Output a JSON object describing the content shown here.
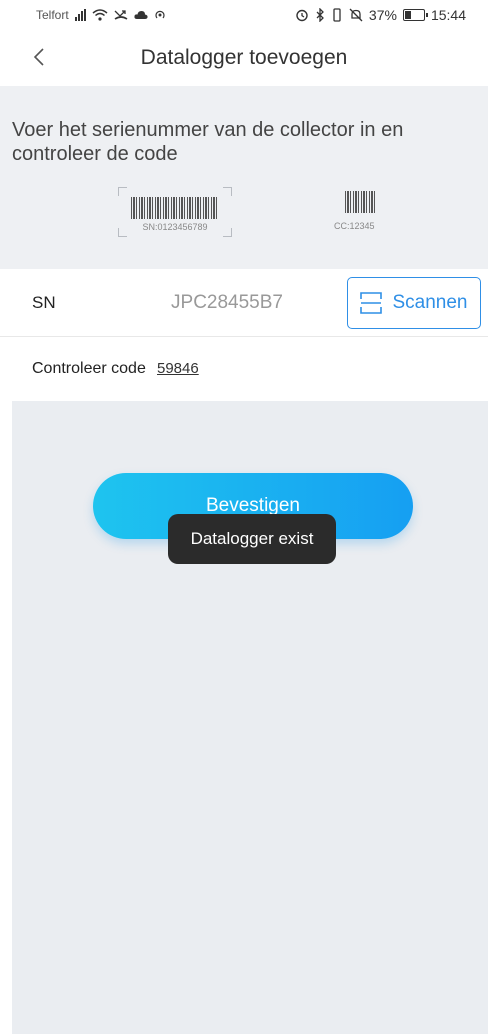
{
  "status_bar": {
    "carrier": "Telfort",
    "battery_percent": "37%",
    "battery_level": 0.37,
    "time": "15:44",
    "icons": [
      "signal-icon",
      "wifi-icon",
      "missed-call-icon",
      "cloud-icon",
      "hotspot-icon",
      "alarm-icon",
      "bluetooth-icon",
      "vibrate-icon",
      "do-not-disturb-icon",
      "battery-icon"
    ]
  },
  "header": {
    "title": "Datalogger toevoegen",
    "back_icon": "chevron-left-icon"
  },
  "instructions": {
    "text": "Voer het serienummer van de collector in en controleer de code",
    "sample_sn": "SN:0123456789",
    "sample_cc": "CC:12345"
  },
  "form": {
    "sn_label": "SN",
    "sn_value": "JPC28455B7",
    "scan_label": "Scannen",
    "scan_icon": "scan-icon",
    "code_label": "Controleer code",
    "code_value": "59846"
  },
  "confirm_label": "Bevestigen",
  "toast": "Datalogger exist",
  "colors": {
    "accent": "#2f8fe6",
    "button_gradient_start": "#1ec4ef",
    "button_gradient_end": "#169ff2",
    "background_gray": "#eaedf1"
  }
}
